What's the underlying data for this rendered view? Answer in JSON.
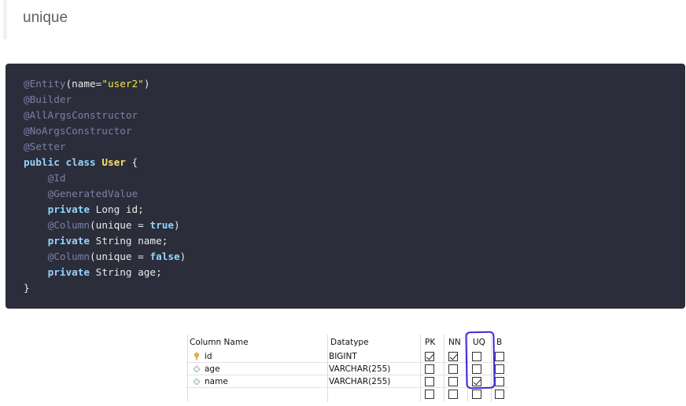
{
  "heading": "unique",
  "code": {
    "lines": [
      [
        {
          "t": "@Entity",
          "c": "annot"
        },
        {
          "t": "(name=",
          "c": ""
        },
        {
          "t": "\"user2\"",
          "c": "str"
        },
        {
          "t": ")",
          "c": ""
        }
      ],
      [
        {
          "t": "@Builder",
          "c": "annot"
        }
      ],
      [
        {
          "t": "@AllArgsConstructor",
          "c": "annot"
        }
      ],
      [
        {
          "t": "@NoArgsConstructor",
          "c": "annot"
        }
      ],
      [
        {
          "t": "@Setter",
          "c": "annot"
        }
      ],
      [
        {
          "t": "public",
          "c": "kw"
        },
        {
          "t": " ",
          "c": ""
        },
        {
          "t": "class",
          "c": "kw"
        },
        {
          "t": " ",
          "c": ""
        },
        {
          "t": "User",
          "c": "cls"
        },
        {
          "t": " {",
          "c": ""
        }
      ],
      [
        {
          "t": "    ",
          "c": ""
        },
        {
          "t": "@Id",
          "c": "annot"
        }
      ],
      [
        {
          "t": "    ",
          "c": ""
        },
        {
          "t": "@GeneratedValue",
          "c": "annot"
        }
      ],
      [
        {
          "t": "    ",
          "c": ""
        },
        {
          "t": "private",
          "c": "kw"
        },
        {
          "t": " Long id;",
          "c": ""
        }
      ],
      [
        {
          "t": "    ",
          "c": ""
        },
        {
          "t": "@Column",
          "c": "annot"
        },
        {
          "t": "(unique = ",
          "c": ""
        },
        {
          "t": "true",
          "c": "kw"
        },
        {
          "t": ")",
          "c": ""
        }
      ],
      [
        {
          "t": "    ",
          "c": ""
        },
        {
          "t": "private",
          "c": "kw"
        },
        {
          "t": " String name;",
          "c": ""
        }
      ],
      [
        {
          "t": "    ",
          "c": ""
        },
        {
          "t": "@Column",
          "c": "annot"
        },
        {
          "t": "(unique = ",
          "c": ""
        },
        {
          "t": "false",
          "c": "kw"
        },
        {
          "t": ")",
          "c": ""
        }
      ],
      [
        {
          "t": "    ",
          "c": ""
        },
        {
          "t": "private",
          "c": "kw"
        },
        {
          "t": " String age;",
          "c": ""
        }
      ],
      [
        {
          "t": "}",
          "c": ""
        }
      ]
    ]
  },
  "table": {
    "headers": {
      "column_name": "Column Name",
      "datatype": "Datatype",
      "pk": "PK",
      "nn": "NN",
      "uq": "UQ",
      "b": "B"
    },
    "rows": [
      {
        "icon": "primary-key-icon",
        "name": "id",
        "datatype": "BIGINT",
        "pk": true,
        "nn": true,
        "uq": false,
        "b": false
      },
      {
        "icon": "column-diamond-icon",
        "name": "age",
        "datatype": "VARCHAR(255)",
        "pk": false,
        "nn": false,
        "uq": false,
        "b": false
      },
      {
        "icon": "column-diamond-icon",
        "name": "name",
        "datatype": "VARCHAR(255)",
        "pk": false,
        "nn": false,
        "uq": true,
        "b": false
      },
      {
        "icon": "",
        "name": "",
        "datatype": "",
        "pk": false,
        "nn": false,
        "uq": false,
        "b": false
      }
    ]
  },
  "colors": {
    "code_bg": "#2b2d3a",
    "highlight": "#3b2bd6",
    "annotation": "#7d7fa6",
    "keyword": "#94d3fc",
    "string": "#f4e04d"
  }
}
